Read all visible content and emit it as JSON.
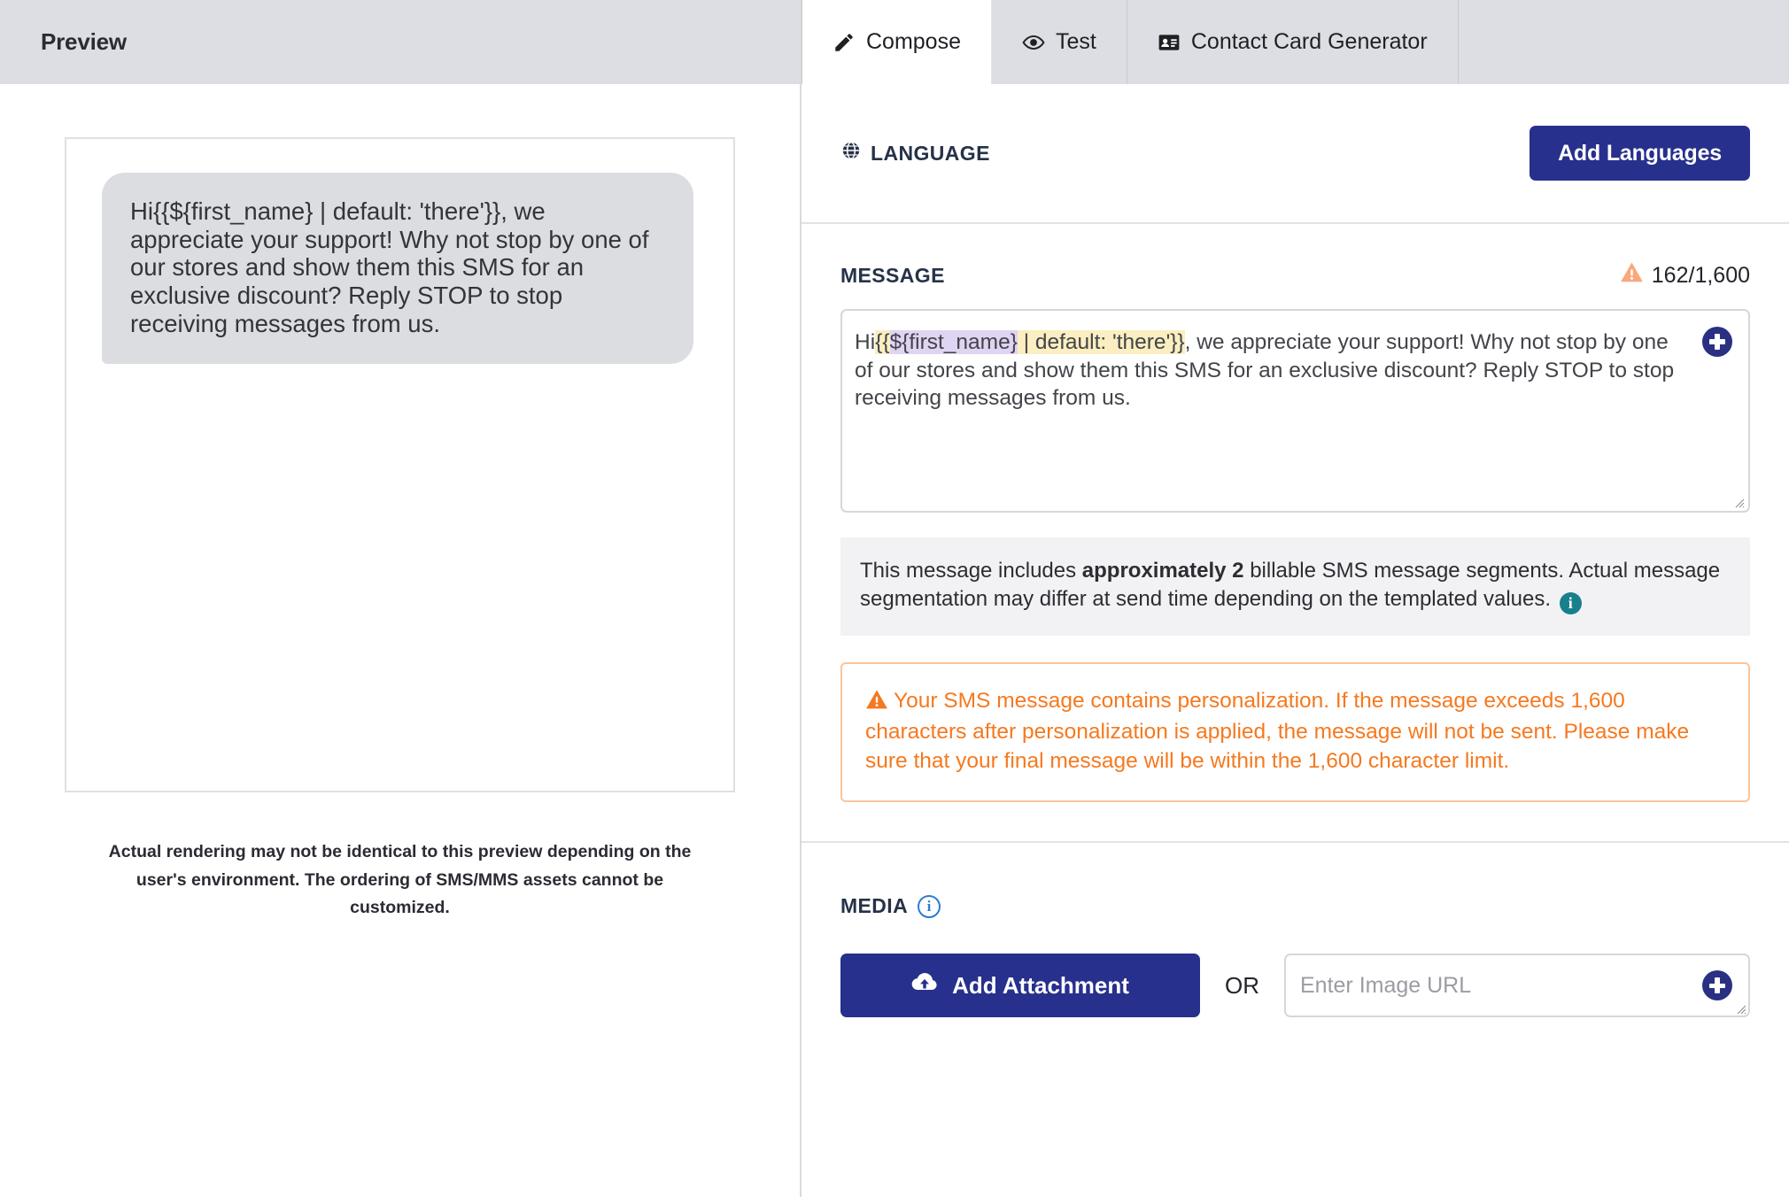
{
  "preview": {
    "header_title": "Preview",
    "bubble_message": "Hi{{${first_name} | default: 'there'}}, we appreciate your support! Why not stop by one of our stores and show them this SMS for an exclusive discount? Reply STOP to stop receiving messages from us.",
    "disclaimer": "Actual rendering may not be identical to this preview depending on the user's environment. The ordering of SMS/MMS assets cannot be customized."
  },
  "tabs": [
    {
      "label": "Compose",
      "icon": "pencil-icon",
      "active": true
    },
    {
      "label": "Test",
      "icon": "eye-icon",
      "active": false
    },
    {
      "label": "Contact Card Generator",
      "icon": "contact-card-icon",
      "active": false
    }
  ],
  "language": {
    "label": "LANGUAGE",
    "icon": "globe-icon",
    "add_button": "Add Languages"
  },
  "message": {
    "label": "MESSAGE",
    "counter": "162/1,600",
    "counter_icon": "warning-triangle-icon",
    "char_used": 162,
    "char_limit": 1600,
    "segments": {
      "tokens": [
        {
          "text": "Hi",
          "style": "plain"
        },
        {
          "text": "{{",
          "style": "yellow"
        },
        {
          "text": "${first_name}",
          "style": "purple"
        },
        {
          "text": " | default: 'there'}}",
          "style": "yellow"
        },
        {
          "text": ", we appreciate your support! Why not stop by one of our stores and show them this SMS for an exclusive discount? Reply STOP to stop receiving messages from us.",
          "style": "plain"
        }
      ]
    },
    "add_personalization_icon": "plus-circle-icon",
    "resize_handle": "resize-grip-icon"
  },
  "segment_note": {
    "prefix": "This message includes ",
    "emphasis": "approximately 2",
    "suffix": " billable SMS message segments. Actual message segmentation may differ at send time depending on the templated values.",
    "info_icon": "info-circle-icon"
  },
  "personalization_warning": {
    "icon": "warning-triangle-icon",
    "text": "Your SMS message contains personalization. If the message exceeds 1,600 characters after personalization is applied, the message will not be sent. Please make sure that your final message will be within the 1,600 character limit."
  },
  "media": {
    "label": "MEDIA",
    "info_icon": "info-circle-icon",
    "add_attachment_label": "Add Attachment",
    "add_attachment_icon": "cloud-upload-icon",
    "or_label": "OR",
    "url_placeholder": "Enter Image URL",
    "url_value": "",
    "url_add_icon": "plus-circle-icon"
  },
  "colors": {
    "brand_navy": "#27308C",
    "header_gray": "#DDDEE3",
    "warning_orange": "#F5791F",
    "warning_orange_border": "#FBC49A",
    "warning_triangle": "#F9A87C",
    "info_teal": "#17808C",
    "info_blue": "#2B7CD3",
    "highlight_yellow": "#FBEEC0",
    "highlight_purple": "#DFD4F2",
    "bubble_gray": "#DCDDE1"
  }
}
